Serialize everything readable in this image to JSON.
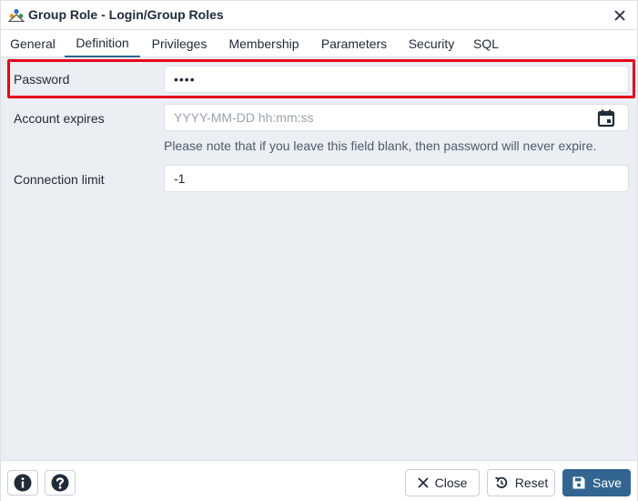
{
  "window": {
    "title": "Group Role - Login/Group Roles",
    "icon": "group-role-icon",
    "close_icon": "close-icon"
  },
  "tabs": [
    {
      "label": "General",
      "active": false
    },
    {
      "label": "Definition",
      "active": true
    },
    {
      "label": "Privileges",
      "active": false
    },
    {
      "label": "Membership",
      "active": false
    },
    {
      "label": "Parameters",
      "active": false
    },
    {
      "label": "Security",
      "active": false
    },
    {
      "label": "SQL",
      "active": false
    }
  ],
  "form": {
    "password": {
      "label": "Password",
      "value": "••••"
    },
    "account_expires": {
      "label": "Account expires",
      "value": "",
      "placeholder": "YYYY-MM-DD hh:mm:ss",
      "note": "Please note that if you leave this field blank, then password will never expire.",
      "icon": "calendar-icon"
    },
    "connection_limit": {
      "label": "Connection limit",
      "value": "-1"
    }
  },
  "footer": {
    "info_icon": "info-icon",
    "help_icon": "help-icon",
    "close_label": "Close",
    "reset_label": "Reset",
    "save_label": "Save"
  },
  "colors": {
    "primary": "#326690",
    "highlight": "#e6001b",
    "background": "#ebeef3"
  }
}
